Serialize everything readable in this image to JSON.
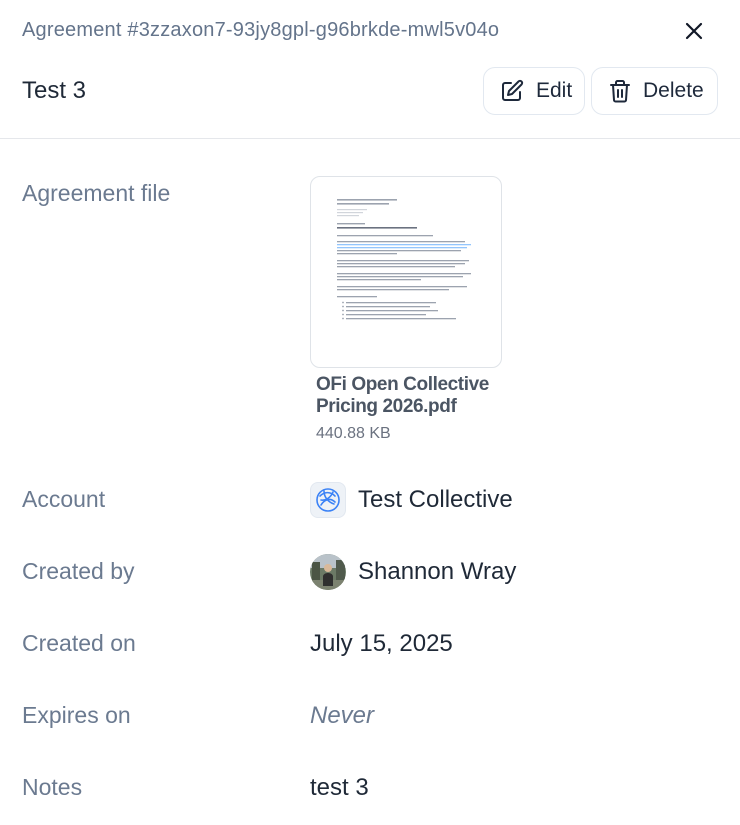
{
  "header": {
    "agreement_id": "Agreement #3zzaxon7-93jy8gpl-g96brkde-mwl5v04o",
    "title": "Test 3",
    "edit_label": "Edit",
    "delete_label": "Delete",
    "close_icon": "close-icon"
  },
  "details": {
    "agreement_file": {
      "label": "Agreement file",
      "file_name": "OFi Open Collective Pricing 2026.pdf",
      "file_size": "440.88 KB"
    },
    "account": {
      "label": "Account",
      "value": "Test Collective",
      "icon": "collective-logo-icon"
    },
    "created_by": {
      "label": "Created by",
      "value": "Shannon Wray"
    },
    "created_on": {
      "label": "Created on",
      "value": "July 15, 2025"
    },
    "expires_on": {
      "label": "Expires on",
      "value": "Never"
    },
    "notes": {
      "label": "Notes",
      "value": "test 3"
    }
  },
  "colors": {
    "label": "#6b7a90",
    "text": "#1f2937",
    "border": "#e2e8f0",
    "accent": "#3b82f6"
  }
}
